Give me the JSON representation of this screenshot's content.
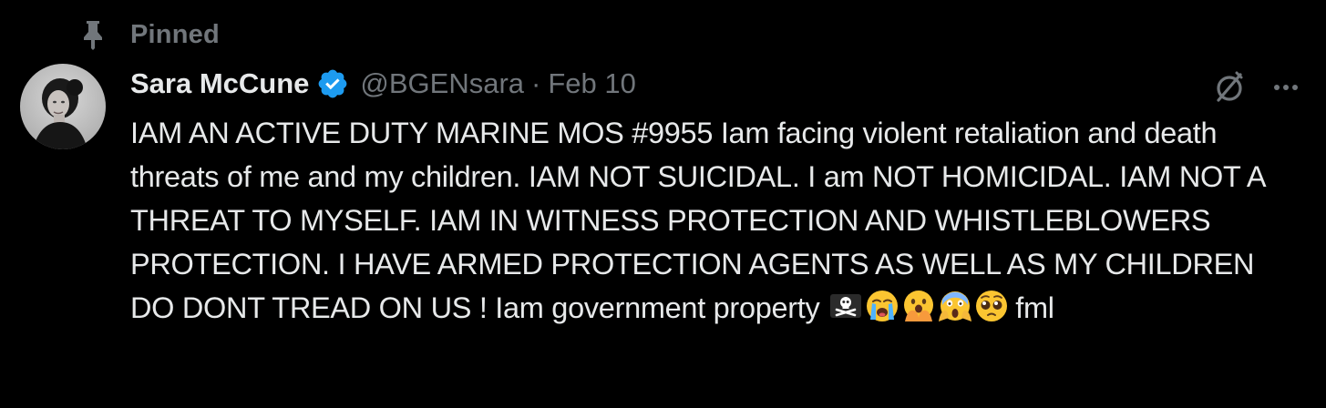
{
  "pinned": {
    "label": "Pinned",
    "icon": "pin-icon"
  },
  "author": {
    "display_name": "Sara McCune",
    "handle": "@BGENsara",
    "separator": "·",
    "date": "Feb 10",
    "verified": true,
    "verified_color": "#1d9bf0"
  },
  "tweet": {
    "text": "IAM AN ACTIVE DUTY MARINE MOS #9955 Iam facing violent retaliation and death threats of me and my children. IAM NOT SUICIDAL. I am NOT HOMICIDAL. IAM NOT A THREAT TO MYSELF. IAM IN WITNESS PROTECTION AND WHISTLEBLOWERS PROTECTION. I HAVE ARMED PROTECTION AGENTS AS WELL AS MY CHILDREN DO DONT TREAD ON US ! Iam government property",
    "emojis": [
      "pirate-flag-icon",
      "loudly-crying-face-icon",
      "face-with-open-eyes-and-hand-over-mouth-icon",
      "face-screaming-in-fear-icon",
      "pleading-face-icon"
    ],
    "trailing_text": "fml"
  },
  "actions": {
    "grok_icon": "grok-icon",
    "more_icon": "more-icon"
  },
  "colors": {
    "background": "#000000",
    "primary_text": "#e7e9ea",
    "secondary_text": "#71767b",
    "verified_blue": "#1d9bf0"
  }
}
